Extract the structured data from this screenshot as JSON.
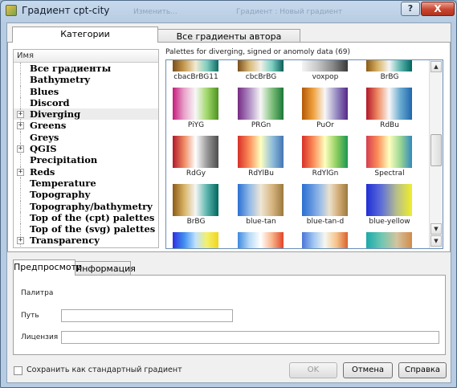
{
  "window": {
    "title": "Градиент cpt-city",
    "behind_left": "Изменить...",
    "behind_right": "Градиент : Новый градиент"
  },
  "titlebar": {
    "help_glyph": "?",
    "close_glyph": "X"
  },
  "tabs": {
    "categories": "Категории",
    "author_gradients": "Все градиенты автора"
  },
  "tree": {
    "header": "Имя",
    "items": [
      {
        "label": "Все градиенты",
        "expandable": false
      },
      {
        "label": "Bathymetry",
        "expandable": false
      },
      {
        "label": "Blues",
        "expandable": false
      },
      {
        "label": "Discord",
        "expandable": false
      },
      {
        "label": "Diverging",
        "expandable": true,
        "selected": true
      },
      {
        "label": "Greens",
        "expandable": true
      },
      {
        "label": "Greys",
        "expandable": false
      },
      {
        "label": "QGIS",
        "expandable": true
      },
      {
        "label": "Precipitation",
        "expandable": false
      },
      {
        "label": "Reds",
        "expandable": true
      },
      {
        "label": "Temperature",
        "expandable": false
      },
      {
        "label": "Topography",
        "expandable": false
      },
      {
        "label": "Topography/bathymetry",
        "expandable": false
      },
      {
        "label": "Top of the (cpt) palettes",
        "expandable": false
      },
      {
        "label": "Top of the (svg) palettes",
        "expandable": false
      },
      {
        "label": "Transparency",
        "expandable": true
      }
    ]
  },
  "palettes": {
    "caption": "Palettes for diverging, signed or anomoly data (69)",
    "items": [
      {
        "name": "cbacBrBG11",
        "stops": [
          "#7a4f1a",
          "#c79a4f",
          "#f3ead2",
          "#7fcdbf",
          "#0e6b64"
        ]
      },
      {
        "name": "cbcBrBG",
        "stops": [
          "#7a4f1a",
          "#d8b876",
          "#f3f0e8",
          "#7ccfc2",
          "#0b5e57"
        ]
      },
      {
        "name": "voxpop",
        "stops": [
          "#f4f4f4",
          "#c8c8c8",
          "#8a8a8a",
          "#3a3a3a"
        ]
      },
      {
        "name": "BrBG",
        "stops": [
          "#8c5a16",
          "#d8b365",
          "#f5f5f5",
          "#5ab4ac",
          "#01665e"
        ]
      },
      {
        "name": "PiYG",
        "stops": [
          "#c51b7d",
          "#e9a3c9",
          "#f7f7f7",
          "#a1d76a",
          "#4d9221"
        ]
      },
      {
        "name": "PRGn",
        "stops": [
          "#762a83",
          "#af8dc3",
          "#f7f7f7",
          "#7fbf7b",
          "#1b7837"
        ]
      },
      {
        "name": "PuOr",
        "stops": [
          "#b35806",
          "#f1a340",
          "#f7f7f7",
          "#998ec3",
          "#542788"
        ]
      },
      {
        "name": "RdBu",
        "stops": [
          "#b2182b",
          "#ef8a62",
          "#f7f7f7",
          "#67a9cf",
          "#2166ac"
        ]
      },
      {
        "name": "RdGy",
        "stops": [
          "#b2182b",
          "#ef8a62",
          "#ffffff",
          "#999999",
          "#4d4d4d"
        ]
      },
      {
        "name": "RdYlBu",
        "stops": [
          "#d73027",
          "#fc8d59",
          "#ffffbf",
          "#91bfdb",
          "#4575b4"
        ]
      },
      {
        "name": "RdYlGn",
        "stops": [
          "#d73027",
          "#fc8d59",
          "#ffffbf",
          "#91cf60",
          "#1a9850"
        ]
      },
      {
        "name": "Spectral",
        "stops": [
          "#d53e4f",
          "#fc8d59",
          "#ffffbf",
          "#99d594",
          "#3288bd"
        ]
      },
      {
        "name": "BrBG",
        "stops": [
          "#8c5a16",
          "#d8b365",
          "#f5f5f5",
          "#5ab4ac",
          "#01665e"
        ]
      },
      {
        "name": "blue-tan",
        "stops": [
          "#2a6fd1",
          "#8fb8e8",
          "#efe7d6",
          "#d7b582",
          "#9b7a3d"
        ]
      },
      {
        "name": "blue-tan-d",
        "stops": [
          "#2a6fd1",
          "#5d93de",
          "#9bbde8",
          "#ebe1cd",
          "#d2ac76",
          "#9b7a3d"
        ]
      },
      {
        "name": "blue-yellow",
        "stops": [
          "#1f2fd6",
          "#5f6fd8",
          "#b7bf8a",
          "#f0ee2a"
        ]
      },
      {
        "name": "",
        "stops": [
          "#2f2fe0",
          "#3f8ff0",
          "#bfe2ff",
          "#f4f06a",
          "#f0d51e"
        ]
      },
      {
        "name": "",
        "stops": [
          "#3d88e0",
          "#b6d9f7",
          "#ffffff",
          "#f9b48a",
          "#e0452a"
        ]
      },
      {
        "name": "",
        "stops": [
          "#4a74d8",
          "#9ec5f2",
          "#f5f7ef",
          "#f6c48c",
          "#d9632d"
        ]
      },
      {
        "name": "",
        "stops": [
          "#1aa9a9",
          "#6fc6b2",
          "#d3c49d",
          "#d28a4a"
        ]
      }
    ]
  },
  "bottom_tabs": {
    "preview": "Предпросмотр",
    "info": "Информация"
  },
  "preview": {
    "palette_label": "Палитра",
    "path_label": "Путь",
    "path_value": "",
    "license_label": "Лицензия",
    "license_value": ""
  },
  "footer": {
    "save_default": "Сохранить как стандартный градиент",
    "ok": "OK",
    "cancel": "Отмена",
    "help": "Справка"
  }
}
